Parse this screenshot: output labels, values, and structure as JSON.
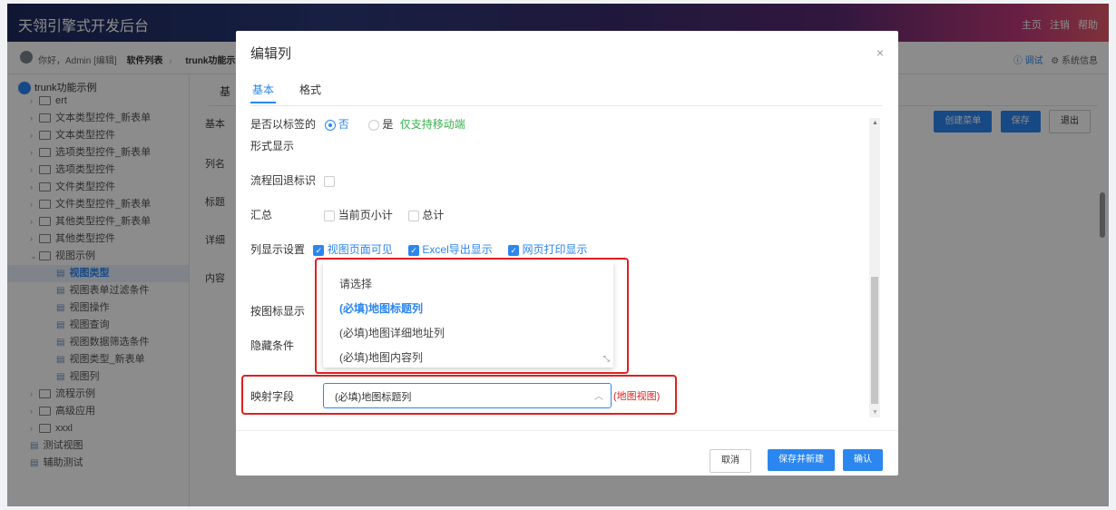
{
  "app": {
    "title": "天翎引擎式开发后台",
    "top_links": [
      "主页",
      "注销",
      "帮助"
    ]
  },
  "crumb": {
    "greeting": "你好，Admin [编辑]",
    "software_list": "软件列表",
    "current": "trunk功能示",
    "debug": "调试",
    "sysinfo": "系统信息"
  },
  "sidebar": {
    "root": "trunk功能示例",
    "items": [
      {
        "label": "ert",
        "kind": "folder",
        "level": 1
      },
      {
        "label": "文本类型控件_新表单",
        "kind": "folder",
        "level": 1
      },
      {
        "label": "文本类型控件",
        "kind": "folder",
        "level": 1
      },
      {
        "label": "选项类型控件_新表单",
        "kind": "folder",
        "level": 1
      },
      {
        "label": "选项类型控件",
        "kind": "folder",
        "level": 1
      },
      {
        "label": "文件类型控件",
        "kind": "folder",
        "level": 1
      },
      {
        "label": "文件类型控件_新表单",
        "kind": "folder",
        "level": 1
      },
      {
        "label": "其他类型控件_新表单",
        "kind": "folder",
        "level": 1
      },
      {
        "label": "其他类型控件",
        "kind": "folder",
        "level": 1
      },
      {
        "label": "视图示例",
        "kind": "folder-open",
        "level": 1
      },
      {
        "label": "视图类型",
        "kind": "doc",
        "level": 2,
        "selected": true
      },
      {
        "label": "视图表单过滤条件",
        "kind": "doc",
        "level": 2
      },
      {
        "label": "视图操作",
        "kind": "doc",
        "level": 2
      },
      {
        "label": "视图查询",
        "kind": "doc",
        "level": 2
      },
      {
        "label": "视图数据筛选条件",
        "kind": "doc",
        "level": 2
      },
      {
        "label": "视图类型_新表单",
        "kind": "doc",
        "level": 2
      },
      {
        "label": "视图列",
        "kind": "doc",
        "level": 2
      },
      {
        "label": "流程示例",
        "kind": "folder",
        "level": 1
      },
      {
        "label": "高级应用",
        "kind": "folder",
        "level": 1
      },
      {
        "label": "xxxl",
        "kind": "folder",
        "level": 1
      },
      {
        "label": "测试视图",
        "kind": "doc",
        "level": 1
      },
      {
        "label": "辅助测试",
        "kind": "doc",
        "level": 1
      }
    ]
  },
  "background": {
    "tab_fragment": "基",
    "labels": [
      "基本",
      "列名",
      "标题",
      "详细",
      "内容"
    ],
    "buttons": [
      "创建菜单",
      "保存",
      "退出"
    ]
  },
  "modal": {
    "title": "编辑列",
    "close": "×",
    "tabs": [
      {
        "label": "基本",
        "active": true
      },
      {
        "label": "格式",
        "active": false
      }
    ],
    "is_tab_label_l1": "是否以标签的",
    "is_tab_label_l2": "形式显示",
    "no": "否",
    "yes": "是",
    "mobile_only": "仅支持移动端",
    "flow_back_label": "流程回退标识",
    "summary_label": "汇总",
    "page_subtotal": "当前页小计",
    "total": "总计",
    "column_display_label": "列显示设置",
    "view_visible": "视图页面可见",
    "excel_export": "Excel导出显示",
    "web_print": "网页打印显示",
    "icon_display_label": "按图标显示",
    "hide_condition_label": "隐藏条件",
    "mapping_label": "映射字段",
    "mapping_value": "(必填)地图标题列",
    "map_view_note": "(地图视图)",
    "dropdown_options": [
      {
        "label": "请选择",
        "active": false
      },
      {
        "label": "(必填)地图标题列",
        "active": true
      },
      {
        "label": "(必填)地图详细地址列",
        "active": false
      },
      {
        "label": "(必填)地图内容列",
        "active": false
      }
    ],
    "footer": {
      "cancel": "取消",
      "save_new": "保存并新建",
      "confirm": "确认"
    }
  }
}
